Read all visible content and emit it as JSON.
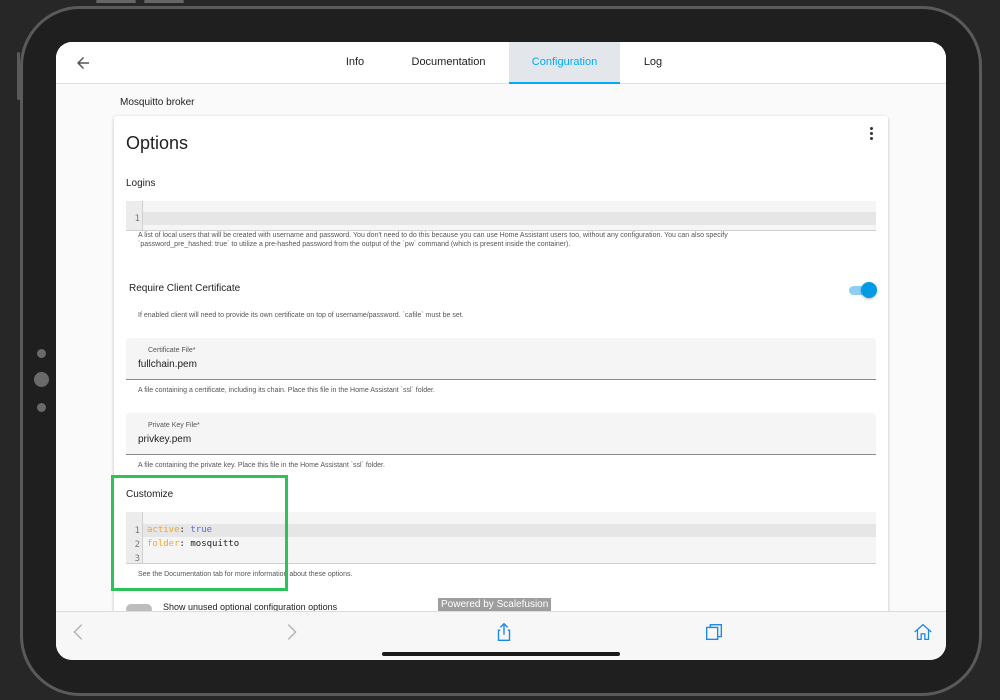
{
  "header": {
    "tabs": [
      {
        "label": "Info"
      },
      {
        "label": "Documentation"
      },
      {
        "label": "Configuration"
      },
      {
        "label": "Log"
      }
    ]
  },
  "addon_name": "Mosquitto broker",
  "card": {
    "title": "Options",
    "logins": {
      "label": "Logins",
      "lines": [
        "1"
      ],
      "helper1": "A list of local users that will be created with username and password. You don't need to do this because you can use Home Assistant users too, without any configuration. You can also specify",
      "helper2": "`password_pre_hashed: true` to utilize a pre-hashed password from the output of the `pw` command (which is present inside the container)."
    },
    "require_cert": {
      "label": "Require Client Certificate",
      "helper": "If enabled client will need to provide its own certificate on top of username/password. `cafile` must be set.",
      "enabled": true
    },
    "certfile": {
      "label": "Certificate File*",
      "value": "fullchain.pem",
      "helper": "A file containing a certificate, including its chain. Place this file in the Home Assistant `ssl` folder."
    },
    "keyfile": {
      "label": "Private Key File*",
      "value": "privkey.pem",
      "helper": "A file containing the private key. Place this file in the Home Assistant `ssl` folder."
    },
    "customize": {
      "label": "Customize",
      "line_numbers": [
        "1",
        "2",
        "3"
      ],
      "line1_key": "active",
      "line1_sep": ": ",
      "line1_val": "true",
      "line2_key": "folder",
      "line2_sep": ": ",
      "line2_val": "mosquitto",
      "helper": "See the Documentation tab for more information about these options."
    },
    "unused_label": "Show unused optional configuration options"
  },
  "watermark": "Powered by Scalefusion",
  "colors": {
    "accent": "#03a9f4",
    "highlight": "#2ec25a",
    "yaml_key": "#f5a623",
    "yaml_value": "#5d6bd7"
  },
  "icons": {
    "header": "arrow-left-icon",
    "menu": "more-vertical-icon",
    "browser": [
      "chevron-left-icon",
      "chevron-right-icon",
      "share-icon",
      "tabs-icon",
      "home-icon"
    ]
  }
}
